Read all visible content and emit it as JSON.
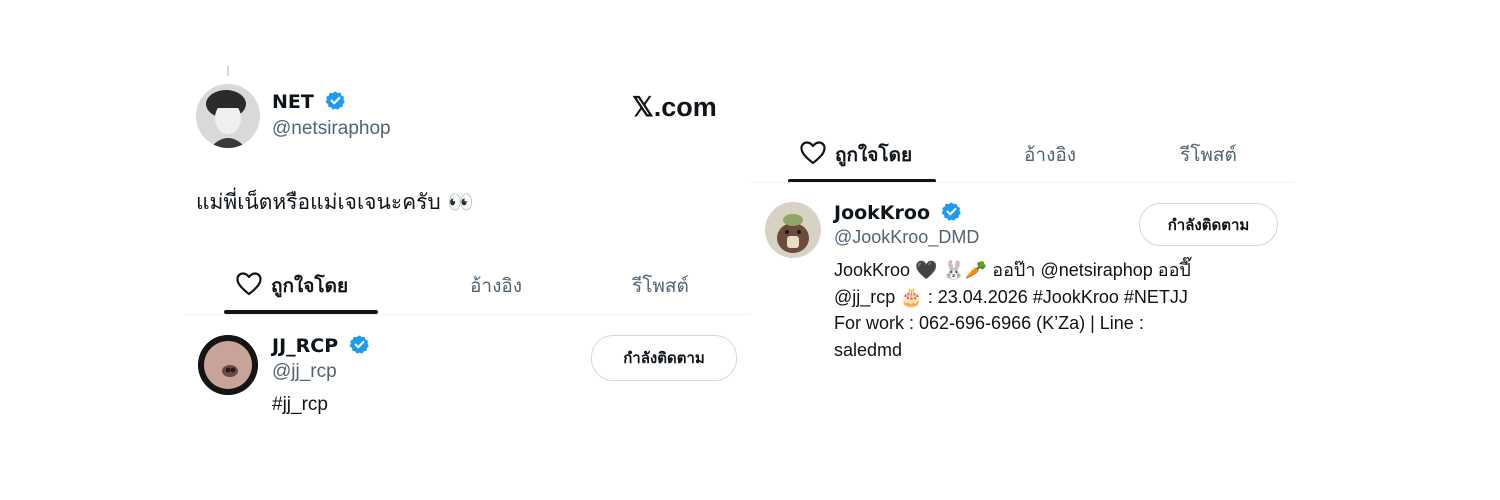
{
  "brand": {
    "logo_text": "𝕏.com",
    "domain_suffix": ".com"
  },
  "left": {
    "author": {
      "name": "NET",
      "handle": "@netsiraphop"
    },
    "tweet_text": "แม่พี่เน็ตหรือแม่เจเจนะครับ",
    "tweet_emoji": "👀",
    "tabs": [
      {
        "label": "ถูกใจโดย",
        "active": true
      },
      {
        "label": "อ้างอิง",
        "active": false
      },
      {
        "label": "รีโพสต์",
        "active": false
      }
    ],
    "user": {
      "name": "JJ_RCP",
      "handle": "@jj_rcp",
      "bio": "#jj_rcp",
      "follow_label": "กำลังติดตาม"
    }
  },
  "right": {
    "tabs": [
      {
        "label": "ถูกใจโดย",
        "active": true
      },
      {
        "label": "อ้างอิง",
        "active": false
      },
      {
        "label": "รีโพสต์",
        "active": false
      }
    ],
    "user": {
      "name": "JookKroo",
      "handle": "@JookKroo_DMD",
      "follow_label": "กำลังติดตาม",
      "bio_line1": "JookKroo 🖤 🐰🥕 ออป๊า @netsiraphop ออปี๊",
      "bio_line2": "@jj_rcp 🎂 : 23.04.2026 #JookKroo #NETJJ",
      "bio_line3": "For work : 062-696-6966 (K’Za) | Line :",
      "bio_line4": "saledmd"
    }
  },
  "colors": {
    "verified": "#1d9bf0",
    "text": "#0f1419",
    "muted": "#536471",
    "border": "#cfd9de"
  }
}
